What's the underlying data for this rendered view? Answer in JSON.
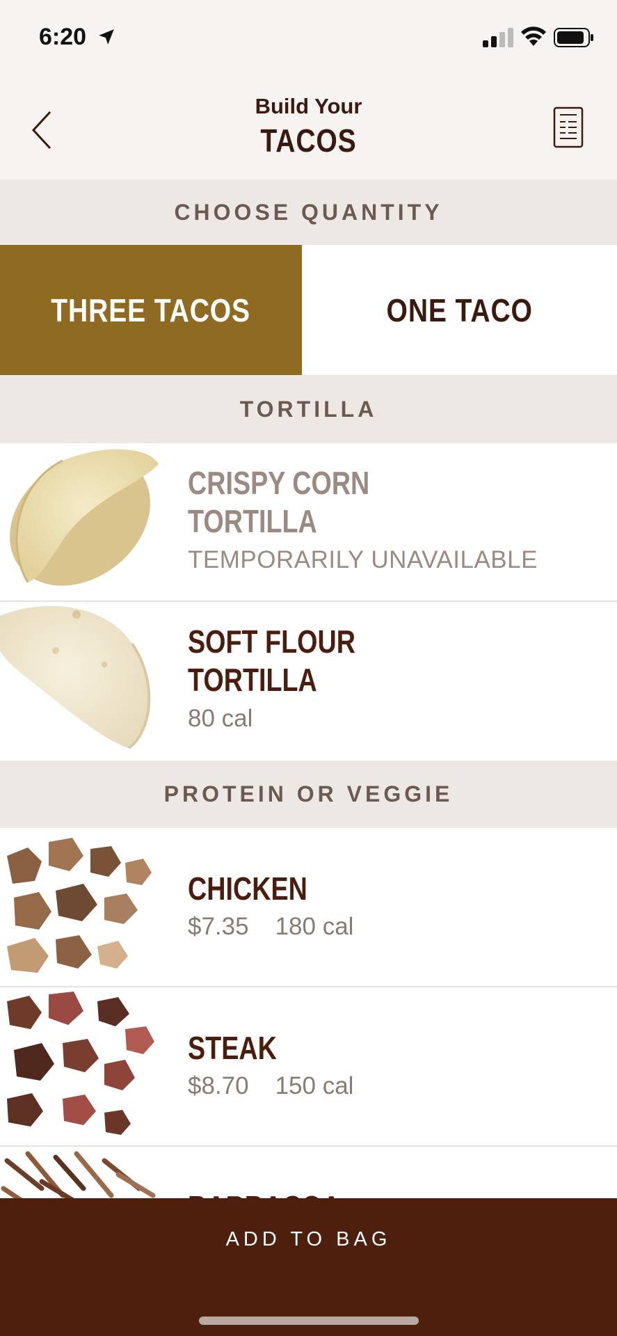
{
  "status": {
    "time": "6:20"
  },
  "nav": {
    "title_pre": "Build Your",
    "title_main": "TACOS"
  },
  "sections": {
    "quantity": "CHOOSE QUANTITY",
    "tortilla": "TORTILLA",
    "protein": "PROTEIN OR VEGGIE"
  },
  "quantity": {
    "three": "THREE TACOS",
    "one": "ONE TACO",
    "selected": "THREE TACOS"
  },
  "tortillas": [
    {
      "name_line1": "CRISPY CORN",
      "name_line2": "TORTILLA",
      "status": "TEMPORARILY UNAVAILABLE"
    },
    {
      "name_line1": "SOFT FLOUR",
      "name_line2": "TORTILLA",
      "cal": "80 cal"
    }
  ],
  "proteins": [
    {
      "name": "CHICKEN",
      "price": "$7.35",
      "cal": "180 cal"
    },
    {
      "name": "STEAK",
      "price": "$8.70",
      "cal": "150 cal"
    },
    {
      "name": "BARBACOA"
    }
  ],
  "bottom": {
    "add_to_bag": "ADD TO BAG"
  },
  "colors": {
    "accent_gold": "#8f6b21",
    "brand_brown": "#4e1f0c"
  }
}
